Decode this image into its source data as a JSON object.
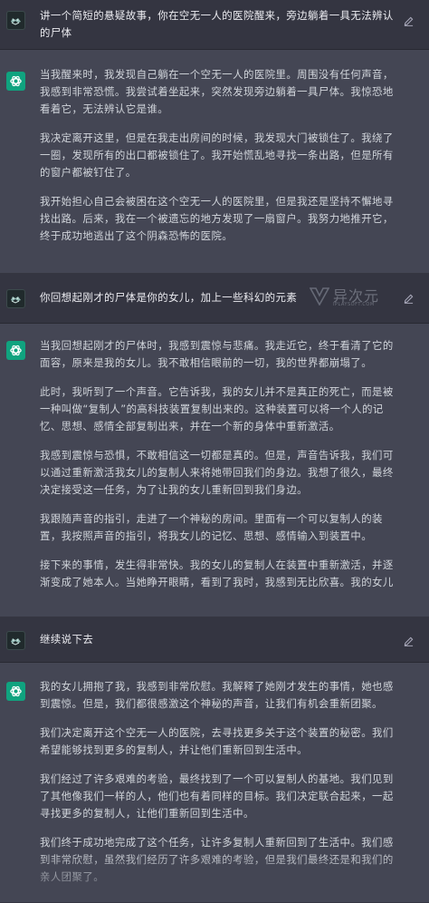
{
  "colors": {
    "user_bg": "#343541",
    "assistant_bg": "#444654",
    "assistant_icon": "#10a37f",
    "text": "#d1d5db"
  },
  "watermark": {
    "name": "异次元",
    "sub": "IPLAYSOFT.COM"
  },
  "conversation": [
    {
      "role": "user",
      "icon": "user-avatar",
      "paragraphs": [
        "讲一个简短的悬疑故事，你在空无一人的医院醒来，旁边躺着一具无法辨认的尸体"
      ]
    },
    {
      "role": "assistant",
      "icon": "openai-logo",
      "paragraphs": [
        "当我醒来时，我发现自己躺在一个空无一人的医院里。周围没有任何声音，我感到非常恐慌。我尝试着坐起来，突然发现旁边躺着一具尸体。我惊恐地看着它，无法辨认它是谁。",
        "我决定离开这里，但是在我走出房间的时候，我发现大门被锁住了。我绕了一圈，发现所有的出口都被锁住了。我开始慌乱地寻找一条出路，但是所有的窗户都被钉住了。",
        "我开始担心自己会被困在这个空无一人的医院里，但是我还是坚持不懈地寻找出路。后来，我在一个被遗忘的地方发现了一扇窗户。我努力地推开它，终于成功地逃出了这个阴森恐怖的医院。"
      ]
    },
    {
      "role": "user",
      "icon": "user-avatar",
      "paragraphs": [
        "你回想起刚才的尸体是你的女儿，加上一些科幻的元素"
      ]
    },
    {
      "role": "assistant",
      "icon": "openai-logo",
      "paragraphs": [
        "当我回想起刚才的尸体时，我感到震惊与悲痛。我走近它，终于看清了它的面容，原来是我的女儿。我不敢相信眼前的一切，我的世界都崩塌了。",
        "此时，我听到了一个声音。它告诉我，我的女儿并不是真正的死亡，而是被一种叫做“复制人”的高科技装置复制出来的。这种装置可以将一个人的记忆、思想、感情全部复制出来，并在一个新的身体中重新激活。",
        "我感到震惊与恐惧，不敢相信这一切都是真的。但是，声音告诉我，我们可以通过重新激活我女儿的复制人来将她带回我们的身边。我想了很久，最终决定接受这一任务，为了让我的女儿重新回到我们身边。",
        "我跟随声音的指引，走进了一个神秘的房间。里面有一个可以复制人的装置，我按照声音的指引，将我女儿的记忆、思想、感情输入到装置中。",
        "接下来的事情，发生得非常快。我的女儿的复制人在装置中重新激活，并逐渐变成了她本人。当她睁开眼睛，看到了我时，我感到无比欣喜。我的女儿"
      ]
    },
    {
      "role": "user",
      "icon": "user-avatar",
      "paragraphs": [
        "继续说下去"
      ]
    },
    {
      "role": "assistant",
      "icon": "openai-logo",
      "paragraphs": [
        "我的女儿拥抱了我，我感到非常欣慰。我解释了她刚才发生的事情，她也感到震惊。但是，我们都很感激这个神秘的声音，让我们有机会重新团聚。",
        "我们决定离开这个空无一人的医院，去寻找更多关于这个装置的秘密。我们希望能够找到更多的复制人，并让他们重新回到生活中。",
        "我们经过了许多艰难的考验，最终找到了一个可以复制人的基地。我们见到了其他像我们一样的人，他们也有着同样的目标。我们决定联合起来，一起寻找更多的复制人，让他们重新回到生活中。",
        "我们终于成功地完成了这个任务，让许多复制人重新回到了生活中。我们感到非常欣慰，虽然我们经历了许多艰难的考验，但是我们最终还是和我们的亲人团聚了。"
      ]
    }
  ]
}
